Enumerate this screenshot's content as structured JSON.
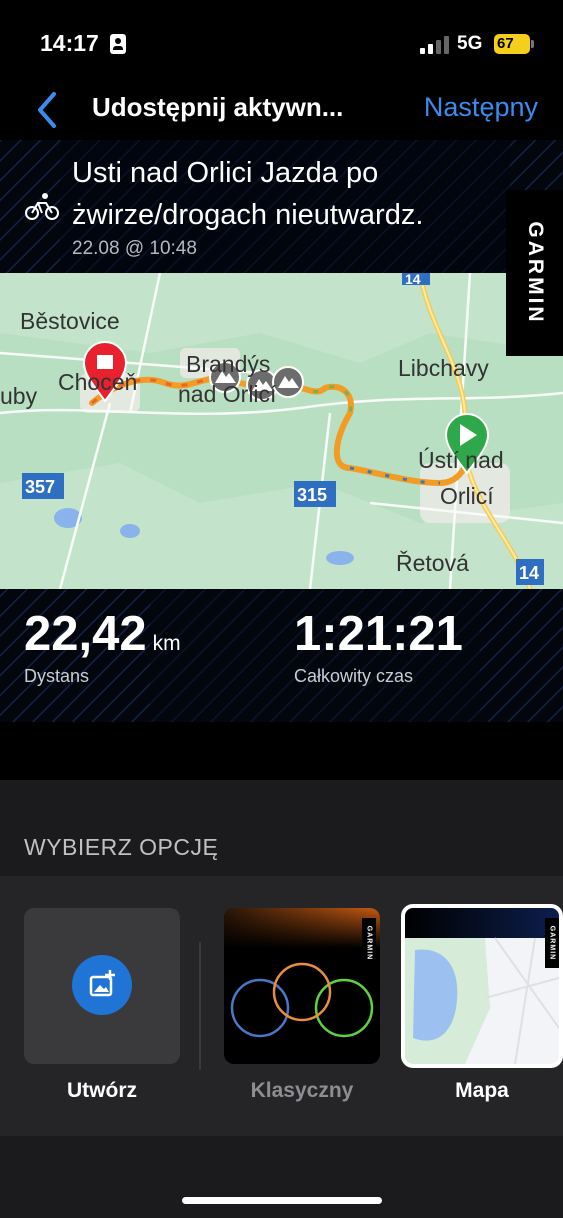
{
  "status_bar": {
    "time": "14:17",
    "network": "5G",
    "battery": "67"
  },
  "nav": {
    "title": "Udostępnij aktywn...",
    "next_label": "Następny"
  },
  "activity": {
    "title": "Usti nad Orlici Jazda po żwirze/drogach nieutwardz.",
    "date": "22.08 @ 10:48",
    "brand": "GARMIN",
    "activity_icon": "bicycle-icon"
  },
  "map": {
    "place_labels": [
      "Běstovice",
      "Choceň",
      "uby",
      "Brandýs",
      "nad Orlicí",
      "Libchavy",
      "Ústí nad",
      "Orlicí",
      "Řetová"
    ],
    "road_labels": [
      "357",
      "315",
      "14",
      "14"
    ],
    "colors": {
      "land": "#b9dfc3",
      "water": "#8bb3eb",
      "route_primary": "#f29b25",
      "start_marker": "#2ea84a",
      "finish_marker": "#e8212f"
    }
  },
  "stats": {
    "distance_value": "22,42",
    "distance_unit": "km",
    "distance_label": "Dystans",
    "time_value": "1:21:21",
    "time_label": "Całkowity czas"
  },
  "options": {
    "header": "WYBIERZ OPCJĘ",
    "items": [
      {
        "label": "Utwórz",
        "icon": "add-photo-icon"
      },
      {
        "label": "Klasyczny"
      },
      {
        "label": "Mapa"
      }
    ],
    "thumb_brand": "GARMIN"
  },
  "colors": {
    "accent": "#3a8df0",
    "battery": "#f5cf1c"
  }
}
